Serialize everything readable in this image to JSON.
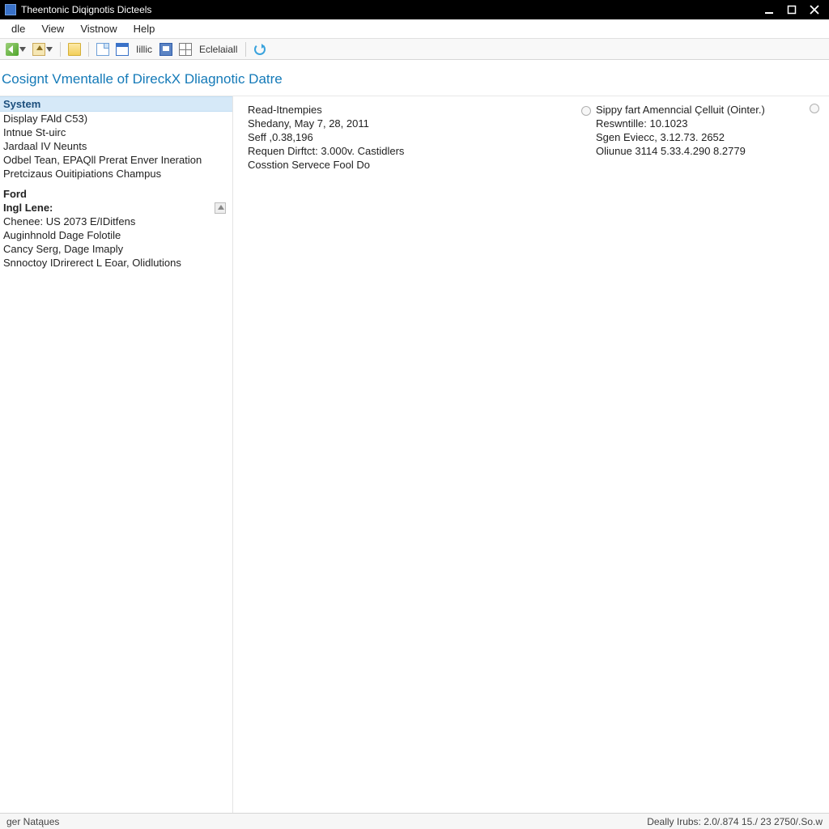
{
  "window": {
    "title": "Theentonic Diqignotis Dicteels"
  },
  "menu": {
    "file": "dle",
    "view": "View",
    "window": "Vistnow",
    "help": "Help"
  },
  "toolbar": {
    "label_hillic": "Iillic",
    "label_eclatall": "Eclelaiall"
  },
  "heading": "Cosignt Vmentalle of DireckX Dliagnotic Datre",
  "sidebar": {
    "system_header": "System",
    "items_a": [
      "Display FAld C53)",
      "Intnue St-uirc",
      "Jardaal IV Neunts",
      "Odbel Tean, EPAQll Prerat Enver Ineration",
      "Pretcizaus Ouitipiations Champus"
    ],
    "ford": "Ford",
    "ingl_lene": "Ingl Lene:",
    "items_b": [
      "Chenee: US 2073 E/IDitfens",
      "Auginhnold Dage Folotile",
      "Cancy Serg, Dage Imaply",
      "Snnoctoy IDrirerect L Eoar, Olidlutions"
    ]
  },
  "mid": {
    "rows": [
      "Read-Itnempies",
      "Shedany, May 7, 28, 2011",
      "Seff ,0.38,196",
      "Requen Dirftct: 3.000v. Castidlers",
      "Cosstion Servece Fool Do"
    ]
  },
  "right": {
    "header": "Sippy fart Amenncial Çelluit (Ointer.)",
    "rows": [
      "Reswntille: 10.1023",
      "Sgen Eviecc, 3.12.73. 2652",
      "Oliunue 3114 5.33.4.290 8.2779"
    ]
  },
  "status": {
    "left": "ger Natąues",
    "right": "Deally Irubs: 2.0/.874 15./ 23 2750/.So.w"
  }
}
